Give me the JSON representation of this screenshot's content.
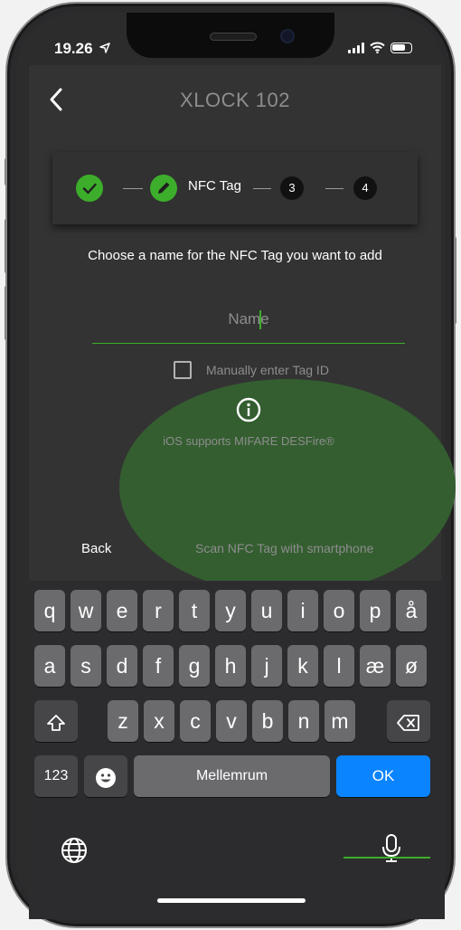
{
  "status": {
    "time": "19.26",
    "location_icon": "location-arrow-icon",
    "signal_icon": "signal-icon",
    "wifi_icon": "wifi-icon",
    "battery_icon": "battery-icon"
  },
  "header": {
    "title": "XLOCK 102",
    "back_icon": "chevron-left-icon"
  },
  "stepper": {
    "step1": {
      "state": "done",
      "icon": "check-icon"
    },
    "step2": {
      "state": "active",
      "icon": "pencil-icon",
      "label": "NFC Tag"
    },
    "step3": {
      "number": "3"
    },
    "step4": {
      "number": "4"
    }
  },
  "form": {
    "prompt": "Choose a name for the NFC Tag you want to add",
    "name_placeholder": "Name",
    "manual_label": "Manually enter Tag ID",
    "manual_checked": false,
    "info_icon": "info-circle-icon",
    "ios_note": "iOS supports MIFARE DESFire®"
  },
  "actions": {
    "back_label": "Back",
    "scan_label": "Scan NFC Tag with smartphone"
  },
  "keyboard": {
    "row1": [
      "q",
      "w",
      "e",
      "r",
      "t",
      "y",
      "u",
      "i",
      "o",
      "p",
      "å"
    ],
    "row2": [
      "a",
      "s",
      "d",
      "f",
      "g",
      "h",
      "j",
      "k",
      "l",
      "æ",
      "ø"
    ],
    "row3": [
      "z",
      "x",
      "c",
      "v",
      "b",
      "n",
      "m"
    ],
    "numbers_label": "123",
    "space_label": "Mellemrum",
    "return_label": "OK",
    "shift_icon": "shift-icon",
    "delete_icon": "backspace-icon",
    "emoji_icon": "emoji-icon",
    "globe_icon": "globe-icon",
    "mic_icon": "microphone-icon"
  },
  "colors": {
    "accent": "#3dae2b",
    "background": "#333333",
    "ok_blue": "#0a84ff"
  }
}
